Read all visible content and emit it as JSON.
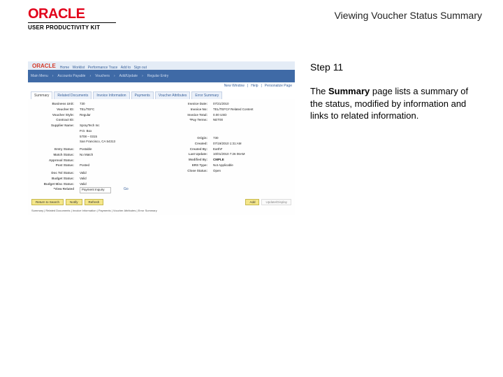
{
  "header": {
    "logo": "ORACLE",
    "upk": "USER PRODUCTIVITY KIT",
    "title": "Viewing Voucher Status Summary"
  },
  "right": {
    "step": "Step 11",
    "text_pre": "The ",
    "text_bold": "Summary",
    "text_post": " page lists a summary of the status, modified by information and links to related information."
  },
  "ss": {
    "oracle": "ORACLE",
    "breadcrumb1": "Main Menu",
    "breadcrumb2": "Accounts Payable",
    "breadcrumb3": "Vouchers",
    "breadcrumb4": "Add/Update",
    "breadcrumb5": "Regular Entry",
    "top_right1": "Home",
    "top_right2": "Worklist",
    "top_right3": "Performance Trace",
    "top_right4": "Add to",
    "top_right5": "Sign out",
    "header_right1": "New Window",
    "header_right2": "Help",
    "header_right3": "Personalize Page",
    "tabs": {
      "t0": "Summary",
      "t1": "Related Documents",
      "t2": "Invoice Information",
      "t3": "Payments",
      "t4": "Voucher Attributes",
      "t5": "Error Summary"
    },
    "fields": {
      "bu_l": "Business Unit:",
      "bu_v": "730",
      "vid_l": "Voucher ID:",
      "vid_v": "TEL/TEFC",
      "vst_l": "Voucher Style:",
      "vst_v": "Regular",
      "cd_l": "Contract ID:",
      "sn_l": "Supplier Name:",
      "sn_v": "SprayTech Inc",
      "sa_l": "",
      "sa_v1": "P.O. Box",
      "sa_v2": "5708 – 0315",
      "sa_v3": "San Francisco, CA 54313",
      "es_l": "Entry Status:",
      "es_v": "Postable",
      "ms_l": "Match Status:",
      "ms_v": "No Match",
      "as_l": "Approval Status:",
      "as_v": "",
      "ps_l": "Post Status:",
      "ps_v": "Posted",
      "dt_l": "Doc Tol Status:",
      "dt_v": "Valid",
      "bs_l": "Budget Status:",
      "bs_v": "Valid",
      "bms_l": "Budget Misc Status:",
      "bms_v": "Valid",
      "vr_l": "*View Related",
      "vr_v": "Payment Inquiry",
      "go": "Go",
      "id_l": "Invoice Date:",
      "id_v": "07/21/2010",
      "ino_l": "Invoice No:",
      "ino_v": "TEL/TEFC# Related Content",
      "it_l": "Invoice Total:",
      "it_v": "0.00      USD",
      "upg_l": "*Pay Terms:",
      "upg_v": "NET00",
      "o_l": "Origin:",
      "o_v": "730",
      "c_l": "Created:",
      "c_v": "07/19/2010 1:31:AM",
      "cb_l": "Created By:",
      "cb_v": "EarthF",
      "lu_l": "Last Update:",
      "lu_v": "10/01/2010 7:26 06AM",
      "mb_l": "Modified By:",
      "mb_v": "CMPLE",
      "et_l": "ERS Type:",
      "et_v": "Not Applicable",
      "ct_l": "Close Status:",
      "ct_v": "Open"
    },
    "buttons": {
      "b1": "Return to Search",
      "b2": "Notify",
      "b3": "Refresh",
      "b4": "Add",
      "b5": "Update/Display"
    },
    "footer": "Summary | Related Documents | Invoice Information | Payments | Voucher Attributes | Error Summary"
  }
}
